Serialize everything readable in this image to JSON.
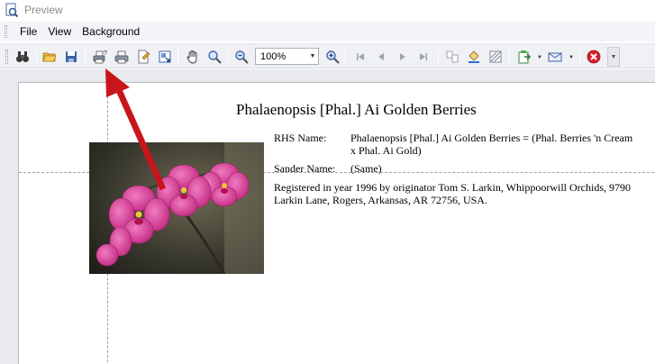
{
  "window": {
    "title": "Preview"
  },
  "menu": {
    "items": [
      "File",
      "View",
      "Background"
    ]
  },
  "toolbar": {
    "zoom_value": "100%"
  },
  "document": {
    "title": "Phalaenopsis [Phal.] Ai Golden Berries",
    "rhs_label": "RHS Name:",
    "rhs_value": "Phalaenopsis [Phal.] Ai Golden Berries = (Phal. Berries 'n Cream x Phal. Ai Gold)",
    "sander_label": "Sander Name:",
    "sander_value": "(Same)",
    "registration": "Registered in year 1996 by originator Tom S. Larkin, Whippoorwill Orchids, 9790 Larkin Lane, Rogers, Arkansas, AR 72756, USA."
  },
  "colors": {
    "accent_arrow": "#c8151b",
    "flower": "#e0479e",
    "close_button": "#d9202c"
  }
}
